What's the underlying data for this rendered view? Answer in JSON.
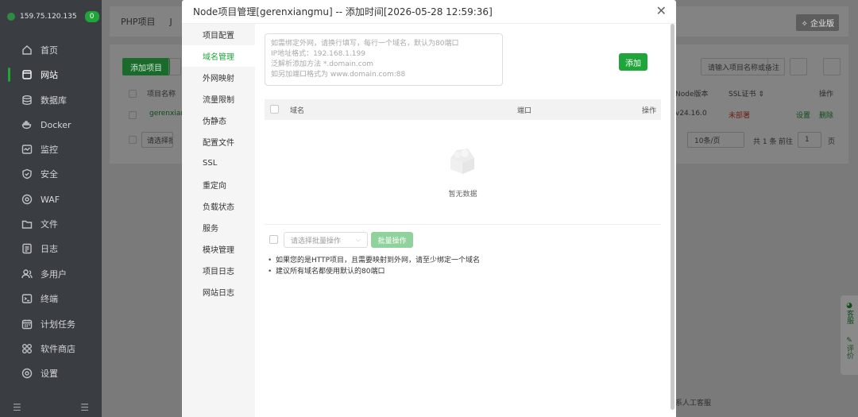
{
  "sidebar": {
    "server_ip": "159.75.120.135",
    "badge": "0",
    "items": [
      {
        "label": "首页",
        "icon": "home-icon"
      },
      {
        "label": "网站",
        "icon": "website-icon"
      },
      {
        "label": "数据库",
        "icon": "database-icon"
      },
      {
        "label": "Docker",
        "icon": "docker-icon"
      },
      {
        "label": "监控",
        "icon": "monitor-icon"
      },
      {
        "label": "安全",
        "icon": "shield-icon"
      },
      {
        "label": "WAF",
        "icon": "waf-icon"
      },
      {
        "label": "文件",
        "icon": "folder-icon"
      },
      {
        "label": "日志",
        "icon": "log-icon"
      },
      {
        "label": "多用户",
        "icon": "users-icon"
      },
      {
        "label": "终端",
        "icon": "terminal-icon"
      },
      {
        "label": "计划任务",
        "icon": "calendar-icon"
      },
      {
        "label": "软件商店",
        "icon": "store-icon"
      },
      {
        "label": "设置",
        "icon": "settings-icon"
      }
    ],
    "active": "网站"
  },
  "background": {
    "tabs": [
      "PHP项目",
      "J"
    ],
    "enterprise_badge": "企业版",
    "add_project": "添加项目",
    "search_placeholder": "请输入项目名称或备注",
    "columns": {
      "project_name": "项目名称",
      "node_version": "Node版本",
      "ssl": "SSL证书",
      "op": "操作"
    },
    "row": {
      "name": "gerenxiang",
      "node_version": "v24.16.0",
      "ssl_status": "未部署",
      "settings": "设置",
      "delete": "删除"
    },
    "batch_placeholder": "请选择批量",
    "per_page": "10条/页",
    "total": "共 1 条",
    "goto": "前往",
    "page": "1",
    "page_suffix": "页",
    "footer_text": "系人工客服",
    "float": {
      "service": "客服",
      "review": "评价"
    }
  },
  "modal": {
    "title": "Node项目管理[gerenxiangmu] -- 添加时间[2026-05-28 12:59:36]",
    "nav": [
      "项目配置",
      "域名管理",
      "外网映射",
      "流量限制",
      "伪静态",
      "配置文件",
      "SSL",
      "重定向",
      "负载状态",
      "服务",
      "模块管理",
      "项目日志",
      "网站日志"
    ],
    "active_nav": "域名管理",
    "domain_placeholder_lines": [
      "如需绑定外网，请换行填写，每行一个域名，默认为80端口",
      "IP地址格式：192.168.1.199",
      "泛解析添加方法 *.domain.com",
      "如另加端口格式为 www.domain.com:88"
    ],
    "add_button": "添加",
    "table": {
      "col_domain": "域名",
      "col_port": "端口",
      "col_op": "操作",
      "empty_text": "暂无数据"
    },
    "batch_placeholder": "请选择批量操作",
    "batch_button": "批量操作",
    "tips": [
      "如果您的是HTTP项目，且需要映射到外网，请至少绑定一个域名",
      "建议所有域名都使用默认的80端口"
    ]
  }
}
